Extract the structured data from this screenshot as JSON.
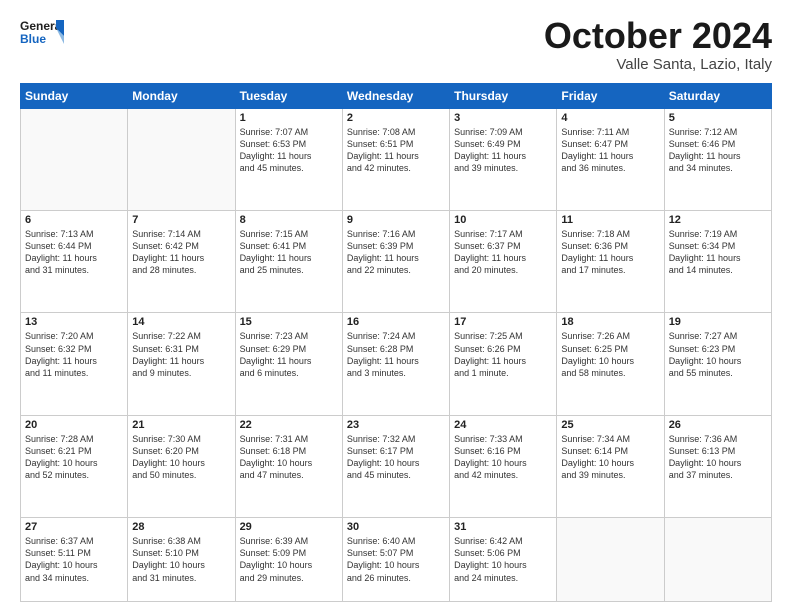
{
  "header": {
    "logo_line1": "General",
    "logo_line2": "Blue",
    "month": "October 2024",
    "location": "Valle Santa, Lazio, Italy"
  },
  "days_of_week": [
    "Sunday",
    "Monday",
    "Tuesday",
    "Wednesday",
    "Thursday",
    "Friday",
    "Saturday"
  ],
  "weeks": [
    [
      {
        "day": "",
        "lines": []
      },
      {
        "day": "",
        "lines": []
      },
      {
        "day": "1",
        "lines": [
          "Sunrise: 7:07 AM",
          "Sunset: 6:53 PM",
          "Daylight: 11 hours",
          "and 45 minutes."
        ]
      },
      {
        "day": "2",
        "lines": [
          "Sunrise: 7:08 AM",
          "Sunset: 6:51 PM",
          "Daylight: 11 hours",
          "and 42 minutes."
        ]
      },
      {
        "day": "3",
        "lines": [
          "Sunrise: 7:09 AM",
          "Sunset: 6:49 PM",
          "Daylight: 11 hours",
          "and 39 minutes."
        ]
      },
      {
        "day": "4",
        "lines": [
          "Sunrise: 7:11 AM",
          "Sunset: 6:47 PM",
          "Daylight: 11 hours",
          "and 36 minutes."
        ]
      },
      {
        "day": "5",
        "lines": [
          "Sunrise: 7:12 AM",
          "Sunset: 6:46 PM",
          "Daylight: 11 hours",
          "and 34 minutes."
        ]
      }
    ],
    [
      {
        "day": "6",
        "lines": [
          "Sunrise: 7:13 AM",
          "Sunset: 6:44 PM",
          "Daylight: 11 hours",
          "and 31 minutes."
        ]
      },
      {
        "day": "7",
        "lines": [
          "Sunrise: 7:14 AM",
          "Sunset: 6:42 PM",
          "Daylight: 11 hours",
          "and 28 minutes."
        ]
      },
      {
        "day": "8",
        "lines": [
          "Sunrise: 7:15 AM",
          "Sunset: 6:41 PM",
          "Daylight: 11 hours",
          "and 25 minutes."
        ]
      },
      {
        "day": "9",
        "lines": [
          "Sunrise: 7:16 AM",
          "Sunset: 6:39 PM",
          "Daylight: 11 hours",
          "and 22 minutes."
        ]
      },
      {
        "day": "10",
        "lines": [
          "Sunrise: 7:17 AM",
          "Sunset: 6:37 PM",
          "Daylight: 11 hours",
          "and 20 minutes."
        ]
      },
      {
        "day": "11",
        "lines": [
          "Sunrise: 7:18 AM",
          "Sunset: 6:36 PM",
          "Daylight: 11 hours",
          "and 17 minutes."
        ]
      },
      {
        "day": "12",
        "lines": [
          "Sunrise: 7:19 AM",
          "Sunset: 6:34 PM",
          "Daylight: 11 hours",
          "and 14 minutes."
        ]
      }
    ],
    [
      {
        "day": "13",
        "lines": [
          "Sunrise: 7:20 AM",
          "Sunset: 6:32 PM",
          "Daylight: 11 hours",
          "and 11 minutes."
        ]
      },
      {
        "day": "14",
        "lines": [
          "Sunrise: 7:22 AM",
          "Sunset: 6:31 PM",
          "Daylight: 11 hours",
          "and 9 minutes."
        ]
      },
      {
        "day": "15",
        "lines": [
          "Sunrise: 7:23 AM",
          "Sunset: 6:29 PM",
          "Daylight: 11 hours",
          "and 6 minutes."
        ]
      },
      {
        "day": "16",
        "lines": [
          "Sunrise: 7:24 AM",
          "Sunset: 6:28 PM",
          "Daylight: 11 hours",
          "and 3 minutes."
        ]
      },
      {
        "day": "17",
        "lines": [
          "Sunrise: 7:25 AM",
          "Sunset: 6:26 PM",
          "Daylight: 11 hours",
          "and 1 minute."
        ]
      },
      {
        "day": "18",
        "lines": [
          "Sunrise: 7:26 AM",
          "Sunset: 6:25 PM",
          "Daylight: 10 hours",
          "and 58 minutes."
        ]
      },
      {
        "day": "19",
        "lines": [
          "Sunrise: 7:27 AM",
          "Sunset: 6:23 PM",
          "Daylight: 10 hours",
          "and 55 minutes."
        ]
      }
    ],
    [
      {
        "day": "20",
        "lines": [
          "Sunrise: 7:28 AM",
          "Sunset: 6:21 PM",
          "Daylight: 10 hours",
          "and 52 minutes."
        ]
      },
      {
        "day": "21",
        "lines": [
          "Sunrise: 7:30 AM",
          "Sunset: 6:20 PM",
          "Daylight: 10 hours",
          "and 50 minutes."
        ]
      },
      {
        "day": "22",
        "lines": [
          "Sunrise: 7:31 AM",
          "Sunset: 6:18 PM",
          "Daylight: 10 hours",
          "and 47 minutes."
        ]
      },
      {
        "day": "23",
        "lines": [
          "Sunrise: 7:32 AM",
          "Sunset: 6:17 PM",
          "Daylight: 10 hours",
          "and 45 minutes."
        ]
      },
      {
        "day": "24",
        "lines": [
          "Sunrise: 7:33 AM",
          "Sunset: 6:16 PM",
          "Daylight: 10 hours",
          "and 42 minutes."
        ]
      },
      {
        "day": "25",
        "lines": [
          "Sunrise: 7:34 AM",
          "Sunset: 6:14 PM",
          "Daylight: 10 hours",
          "and 39 minutes."
        ]
      },
      {
        "day": "26",
        "lines": [
          "Sunrise: 7:36 AM",
          "Sunset: 6:13 PM",
          "Daylight: 10 hours",
          "and 37 minutes."
        ]
      }
    ],
    [
      {
        "day": "27",
        "lines": [
          "Sunrise: 6:37 AM",
          "Sunset: 5:11 PM",
          "Daylight: 10 hours",
          "and 34 minutes."
        ]
      },
      {
        "day": "28",
        "lines": [
          "Sunrise: 6:38 AM",
          "Sunset: 5:10 PM",
          "Daylight: 10 hours",
          "and 31 minutes."
        ]
      },
      {
        "day": "29",
        "lines": [
          "Sunrise: 6:39 AM",
          "Sunset: 5:09 PM",
          "Daylight: 10 hours",
          "and 29 minutes."
        ]
      },
      {
        "day": "30",
        "lines": [
          "Sunrise: 6:40 AM",
          "Sunset: 5:07 PM",
          "Daylight: 10 hours",
          "and 26 minutes."
        ]
      },
      {
        "day": "31",
        "lines": [
          "Sunrise: 6:42 AM",
          "Sunset: 5:06 PM",
          "Daylight: 10 hours",
          "and 24 minutes."
        ]
      },
      {
        "day": "",
        "lines": []
      },
      {
        "day": "",
        "lines": []
      }
    ]
  ]
}
